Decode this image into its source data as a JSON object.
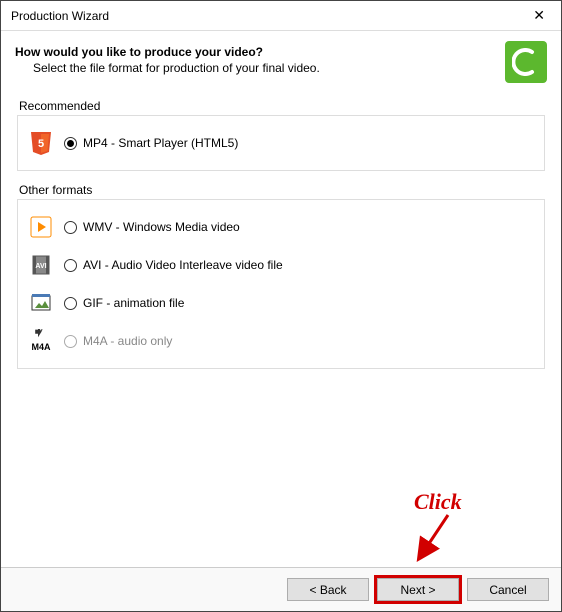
{
  "window": {
    "title": "Production Wizard"
  },
  "header": {
    "heading": "How would you like to produce your video?",
    "subtext": "Select the file format for production of your final video."
  },
  "groups": {
    "recommended": {
      "label": "Recommended",
      "items": [
        {
          "label": "MP4 - Smart Player (HTML5)",
          "selected": true,
          "disabled": false
        }
      ]
    },
    "other": {
      "label": "Other formats",
      "items": [
        {
          "label": "WMV - Windows Media video",
          "selected": false,
          "disabled": false
        },
        {
          "label": "AVI - Audio Video Interleave video file",
          "selected": false,
          "disabled": false
        },
        {
          "label": "GIF - animation file",
          "selected": false,
          "disabled": false
        },
        {
          "label": "M4A - audio only",
          "selected": false,
          "disabled": true
        }
      ]
    }
  },
  "footer": {
    "back": "< Back",
    "next": "Next >",
    "cancel": "Cancel"
  },
  "annotation": {
    "click": "Click"
  }
}
